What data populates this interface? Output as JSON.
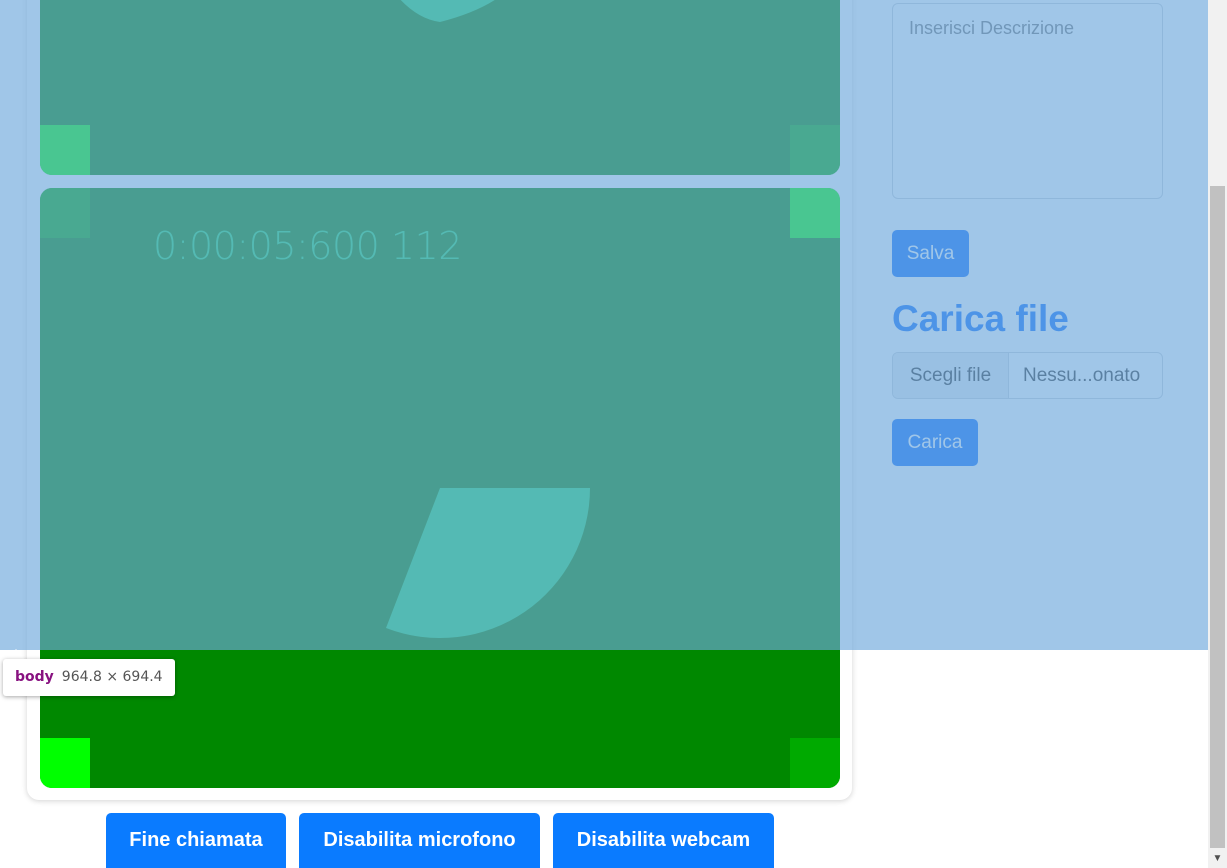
{
  "video": {
    "timer_text": "0:00:05:600 112"
  },
  "side_panel": {
    "description_placeholder": "Inserisci Descrizione",
    "save_label": "Salva",
    "upload_title": "Carica file",
    "file_choose_label": "Scegli file",
    "file_name_label": "Nessu...onato",
    "upload_label": "Carica"
  },
  "controls": {
    "end_call_label": "Fine chiamata",
    "disable_mic_label": "Disabilita microfono",
    "disable_webcam_label": "Disabilita webcam"
  },
  "devtools": {
    "element_tag": "body",
    "element_dimensions": "964.8 × 694.4"
  },
  "colors": {
    "primary": "#0d6efd",
    "video_background": "#008800",
    "video_accent": "#22dd66",
    "highlight_overlay": "#6fa8dc"
  }
}
